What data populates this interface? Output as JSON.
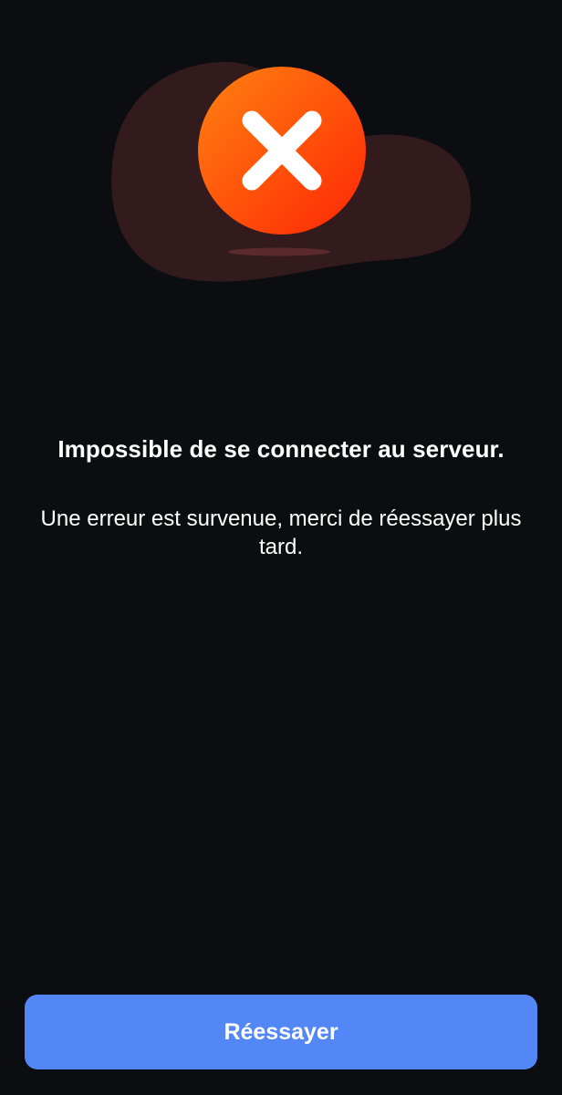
{
  "illustration": {
    "icon": "close-x-icon",
    "blob_color": "#331a1c",
    "circle_gradient": [
      "#ff7a10",
      "#ff2a05"
    ]
  },
  "error": {
    "title": "Impossible de se connecter au serveur.",
    "message": "Une erreur est survenue, merci de réessayer plus tard."
  },
  "actions": {
    "retry_label": "Réessayer",
    "retry_color": "#5387f6"
  },
  "colors": {
    "background": "#0b0d11",
    "text": "#ffffff"
  }
}
